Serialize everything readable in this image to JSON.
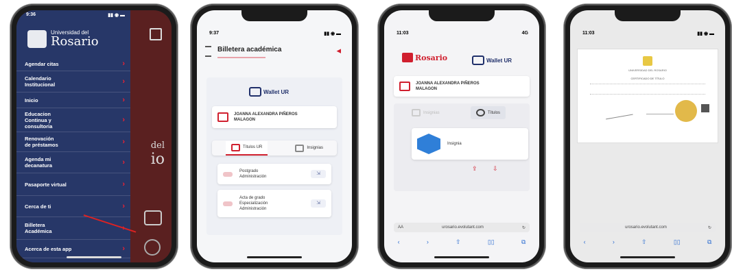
{
  "phone1": {
    "time": "9:36",
    "logo_top": "Universidad del",
    "logo_main": "Rosario",
    "menu": [
      {
        "label": "Agendar citas"
      },
      {
        "label": "Calendario\nInstitucional"
      },
      {
        "label": "Inicio"
      },
      {
        "label": "Educacion\nContinua y\nconsultoria"
      },
      {
        "label": "Renovación\nde préstamos"
      },
      {
        "label": "Agenda mi\ndecanatura"
      },
      {
        "label": "Pasaporte virtual"
      },
      {
        "label": "Cerca de ti"
      },
      {
        "label": "Billetera\nAcadémica"
      },
      {
        "label": "Acerca de esta app"
      }
    ],
    "bg_text_1": "del",
    "bg_text_2": "io"
  },
  "phone2": {
    "time": "9:37",
    "title": "Billetera académica",
    "wallet_label": "Wallet UR",
    "student_name": "JOANNA ALEXANDRA PIÑEROS\nMALAGON",
    "tabs": [
      "Títulos UR",
      "Insignias"
    ],
    "documents": [
      {
        "label": "Postgrado\nAdministración"
      },
      {
        "label": "Acta de grado\nEspecialización\nAdministración"
      }
    ]
  },
  "phone3": {
    "time": "11:03",
    "time_right": "4G",
    "logo": "Rosario",
    "wallet_label": "Wallet UR",
    "student_name": "JOANNA ALEXANDRA PIÑEROS\nMALAGON",
    "tabs": [
      "Insignias",
      "Títulos"
    ],
    "badge_label": "Insignia",
    "url": "urosario.evolutant.com",
    "aa": "AA"
  },
  "phone4": {
    "time": "11:03",
    "url": "urosario.evolutant.com",
    "doc_title": "UNIVERSIDAD DEL ROSARIO",
    "doc_line": "CERTIFICADO DE TÍTULO"
  },
  "colors": {
    "navy": "#273768",
    "red": "#d01f2e"
  }
}
